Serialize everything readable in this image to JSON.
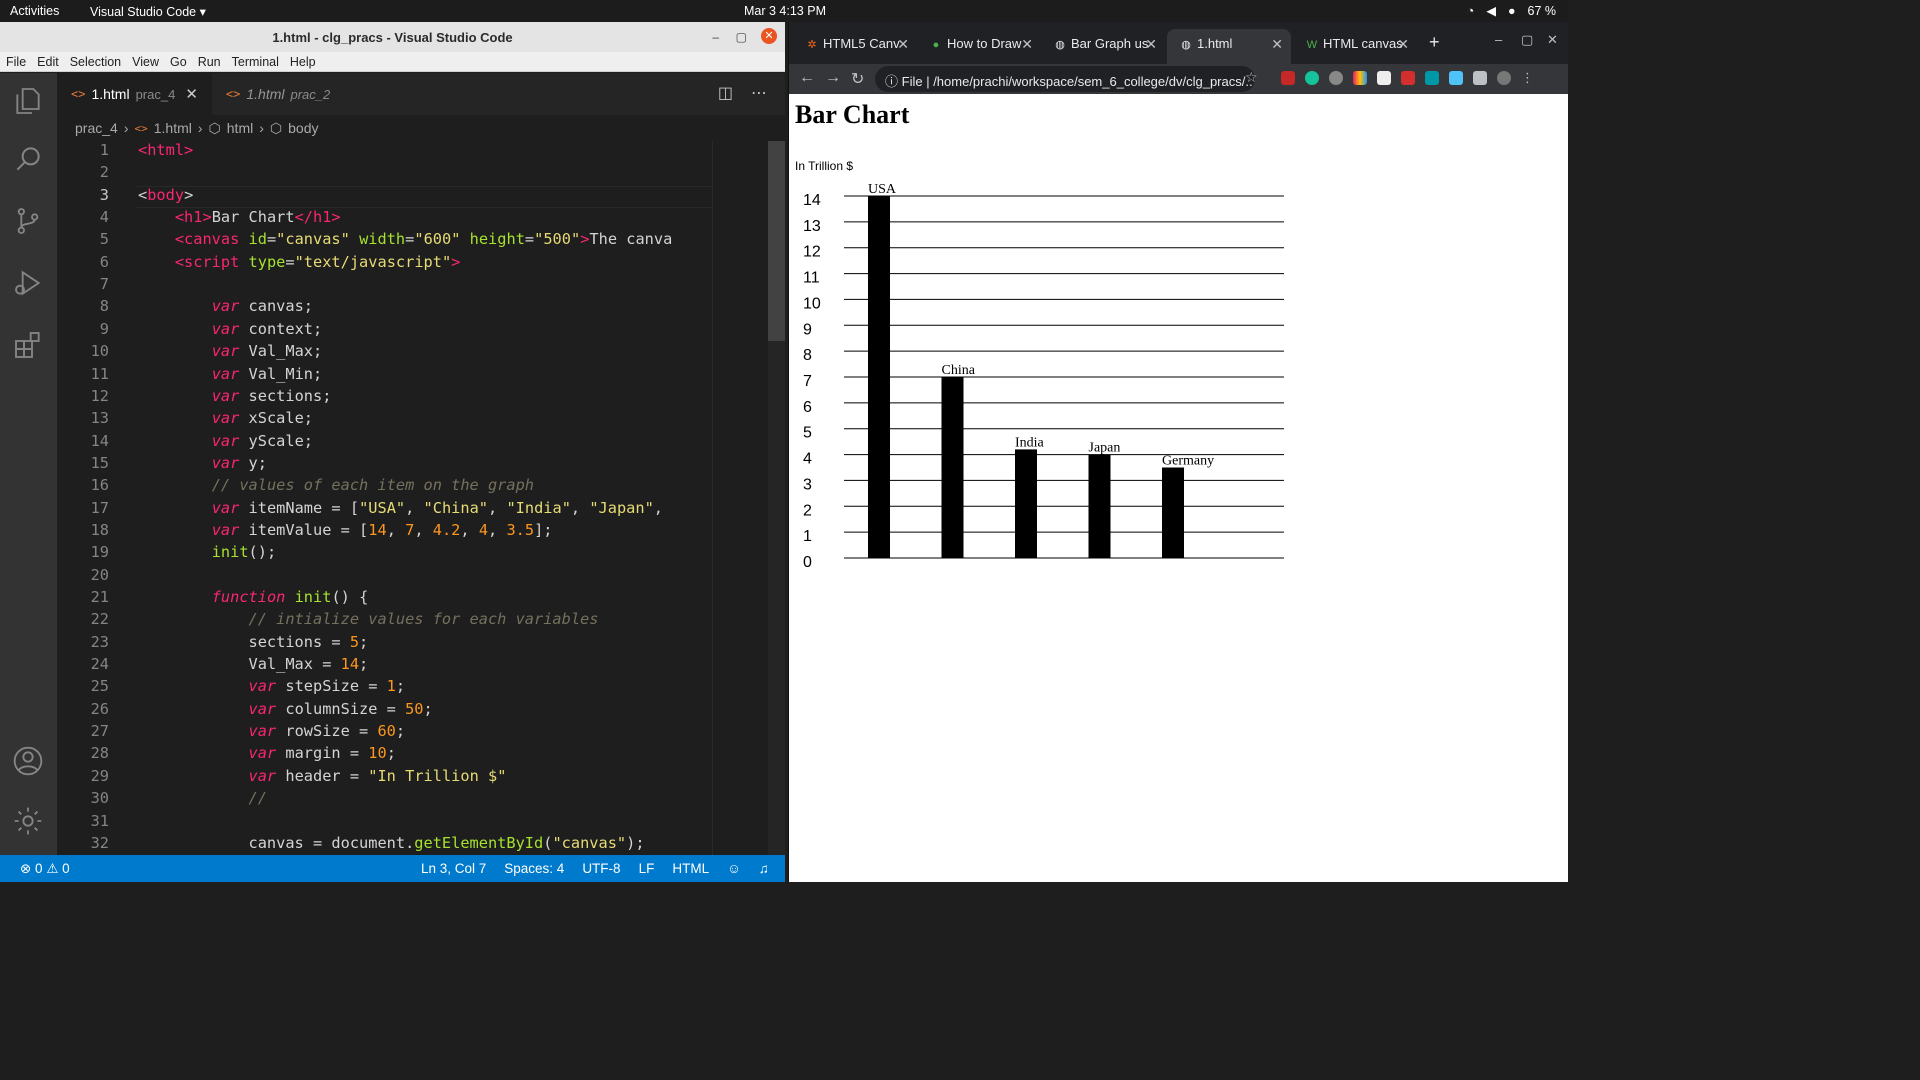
{
  "topbar": {
    "activities": "Activities",
    "app": "Visual Studio Code ▾",
    "clock": "Mar 3  4:13 PM",
    "battery": "67 %"
  },
  "vscode": {
    "title": "1.html - clg_pracs - Visual Studio Code",
    "menu": [
      "File",
      "Edit",
      "Selection",
      "View",
      "Go",
      "Run",
      "Terminal",
      "Help"
    ],
    "tabs": [
      {
        "name": "1.html",
        "sub": "prac_4",
        "close": "✕"
      },
      {
        "name": "1.html",
        "sub": "prac_2"
      }
    ],
    "breadcrumb": [
      "prac_4",
      "1.html",
      "html",
      "body"
    ],
    "code": [
      {
        "n": "1",
        "h": "<span class='t'>&lt;html&gt;</span>"
      },
      {
        "n": "2",
        "h": ""
      },
      {
        "n": "3",
        "h": "<span class='p'>&lt;</span><span class='t'>body</span><span class='p'>&gt;</span>"
      },
      {
        "n": "4",
        "h": "    <span class='t'>&lt;h1&gt;</span>Bar Chart<span class='t'>&lt;/h1&gt;</span>"
      },
      {
        "n": "5",
        "h": "    <span class='t'>&lt;canvas</span> <span class='a'>id</span>=<span class='s'>\"canvas\"</span> <span class='a'>width</span>=<span class='s'>\"600\"</span> <span class='a'>height</span>=<span class='s'>\"500\"</span><span class='t'>&gt;</span>The canva"
      },
      {
        "n": "6",
        "h": "    <span class='t'>&lt;script</span> <span class='a'>type</span>=<span class='s'>\"text/javascript\"</span><span class='t'>&gt;</span>"
      },
      {
        "n": "7",
        "h": ""
      },
      {
        "n": "8",
        "h": "        <span class='k'>var</span> canvas;"
      },
      {
        "n": "9",
        "h": "        <span class='k'>var</span> context;"
      },
      {
        "n": "10",
        "h": "        <span class='k'>var</span> Val_Max;"
      },
      {
        "n": "11",
        "h": "        <span class='k'>var</span> Val_Min;"
      },
      {
        "n": "12",
        "h": "        <span class='k'>var</span> sections;"
      },
      {
        "n": "13",
        "h": "        <span class='k'>var</span> xScale;"
      },
      {
        "n": "14",
        "h": "        <span class='k'>var</span> yScale;"
      },
      {
        "n": "15",
        "h": "        <span class='k'>var</span> y;"
      },
      {
        "n": "16",
        "h": "        <span class='c'>// values of each item on the graph</span>"
      },
      {
        "n": "17",
        "h": "        <span class='k'>var</span> itemName = [<span class='s'>\"USA\"</span>, <span class='s'>\"China\"</span>, <span class='s'>\"India\"</span>, <span class='s'>\"Japan\"</span>,"
      },
      {
        "n": "18",
        "h": "        <span class='k'>var</span> itemValue = [<span class='n'>14</span>, <span class='n'>7</span>, <span class='n'>4.2</span>, <span class='n'>4</span>, <span class='n'>3.5</span>];"
      },
      {
        "n": "19",
        "h": "        <span class='a'>init</span>();"
      },
      {
        "n": "20",
        "h": ""
      },
      {
        "n": "21",
        "h": "        <span class='k'>function</span> <span class='a'>init</span>() {"
      },
      {
        "n": "22",
        "h": "            <span class='c'>// intialize values for each variables</span>"
      },
      {
        "n": "23",
        "h": "            sections = <span class='n'>5</span>;"
      },
      {
        "n": "24",
        "h": "            Val_Max = <span class='n'>14</span>;"
      },
      {
        "n": "25",
        "h": "            <span class='k'>var</span> stepSize = <span class='n'>1</span>;"
      },
      {
        "n": "26",
        "h": "            <span class='k'>var</span> columnSize = <span class='n'>50</span>;"
      },
      {
        "n": "27",
        "h": "            <span class='k'>var</span> rowSize = <span class='n'>60</span>;"
      },
      {
        "n": "28",
        "h": "            <span class='k'>var</span> margin = <span class='n'>10</span>;"
      },
      {
        "n": "29",
        "h": "            <span class='k'>var</span> header = <span class='s'>\"In Trillion $\"</span>"
      },
      {
        "n": "30",
        "h": "            <span class='c'>//</span>"
      },
      {
        "n": "31",
        "h": ""
      },
      {
        "n": "32",
        "h": "            canvas = document.<span class='a'>getElementById</span>(<span class='s'>\"canvas\"</span>);"
      }
    ],
    "status": {
      "problems": "⊗ 0 ⚠ 0",
      "position": "Ln 3, Col 7",
      "spaces": "Spaces: 4",
      "encoding": "UTF-8",
      "eol": "LF",
      "language": "HTML"
    }
  },
  "chrome": {
    "tabs": [
      "HTML5 Canv",
      "How to Draw",
      "Bar Graph us",
      "1.html",
      "HTML canvas"
    ],
    "url_prefix": "File",
    "url": "/home/prachi/workspace/sem_6_college/dv/clg_pracs/..."
  },
  "page": {
    "heading": "Bar Chart"
  },
  "chart_data": {
    "type": "bar",
    "header": "In Trillion $",
    "categories": [
      "USA",
      "China",
      "India",
      "Japan",
      "Germany"
    ],
    "values": [
      14,
      7,
      4.2,
      4,
      3.5
    ],
    "ylim": [
      0,
      14
    ],
    "yticks": [
      14,
      13,
      12,
      11,
      10,
      9,
      8,
      7,
      6,
      5,
      4,
      3,
      2,
      1,
      0
    ],
    "grid": true
  }
}
